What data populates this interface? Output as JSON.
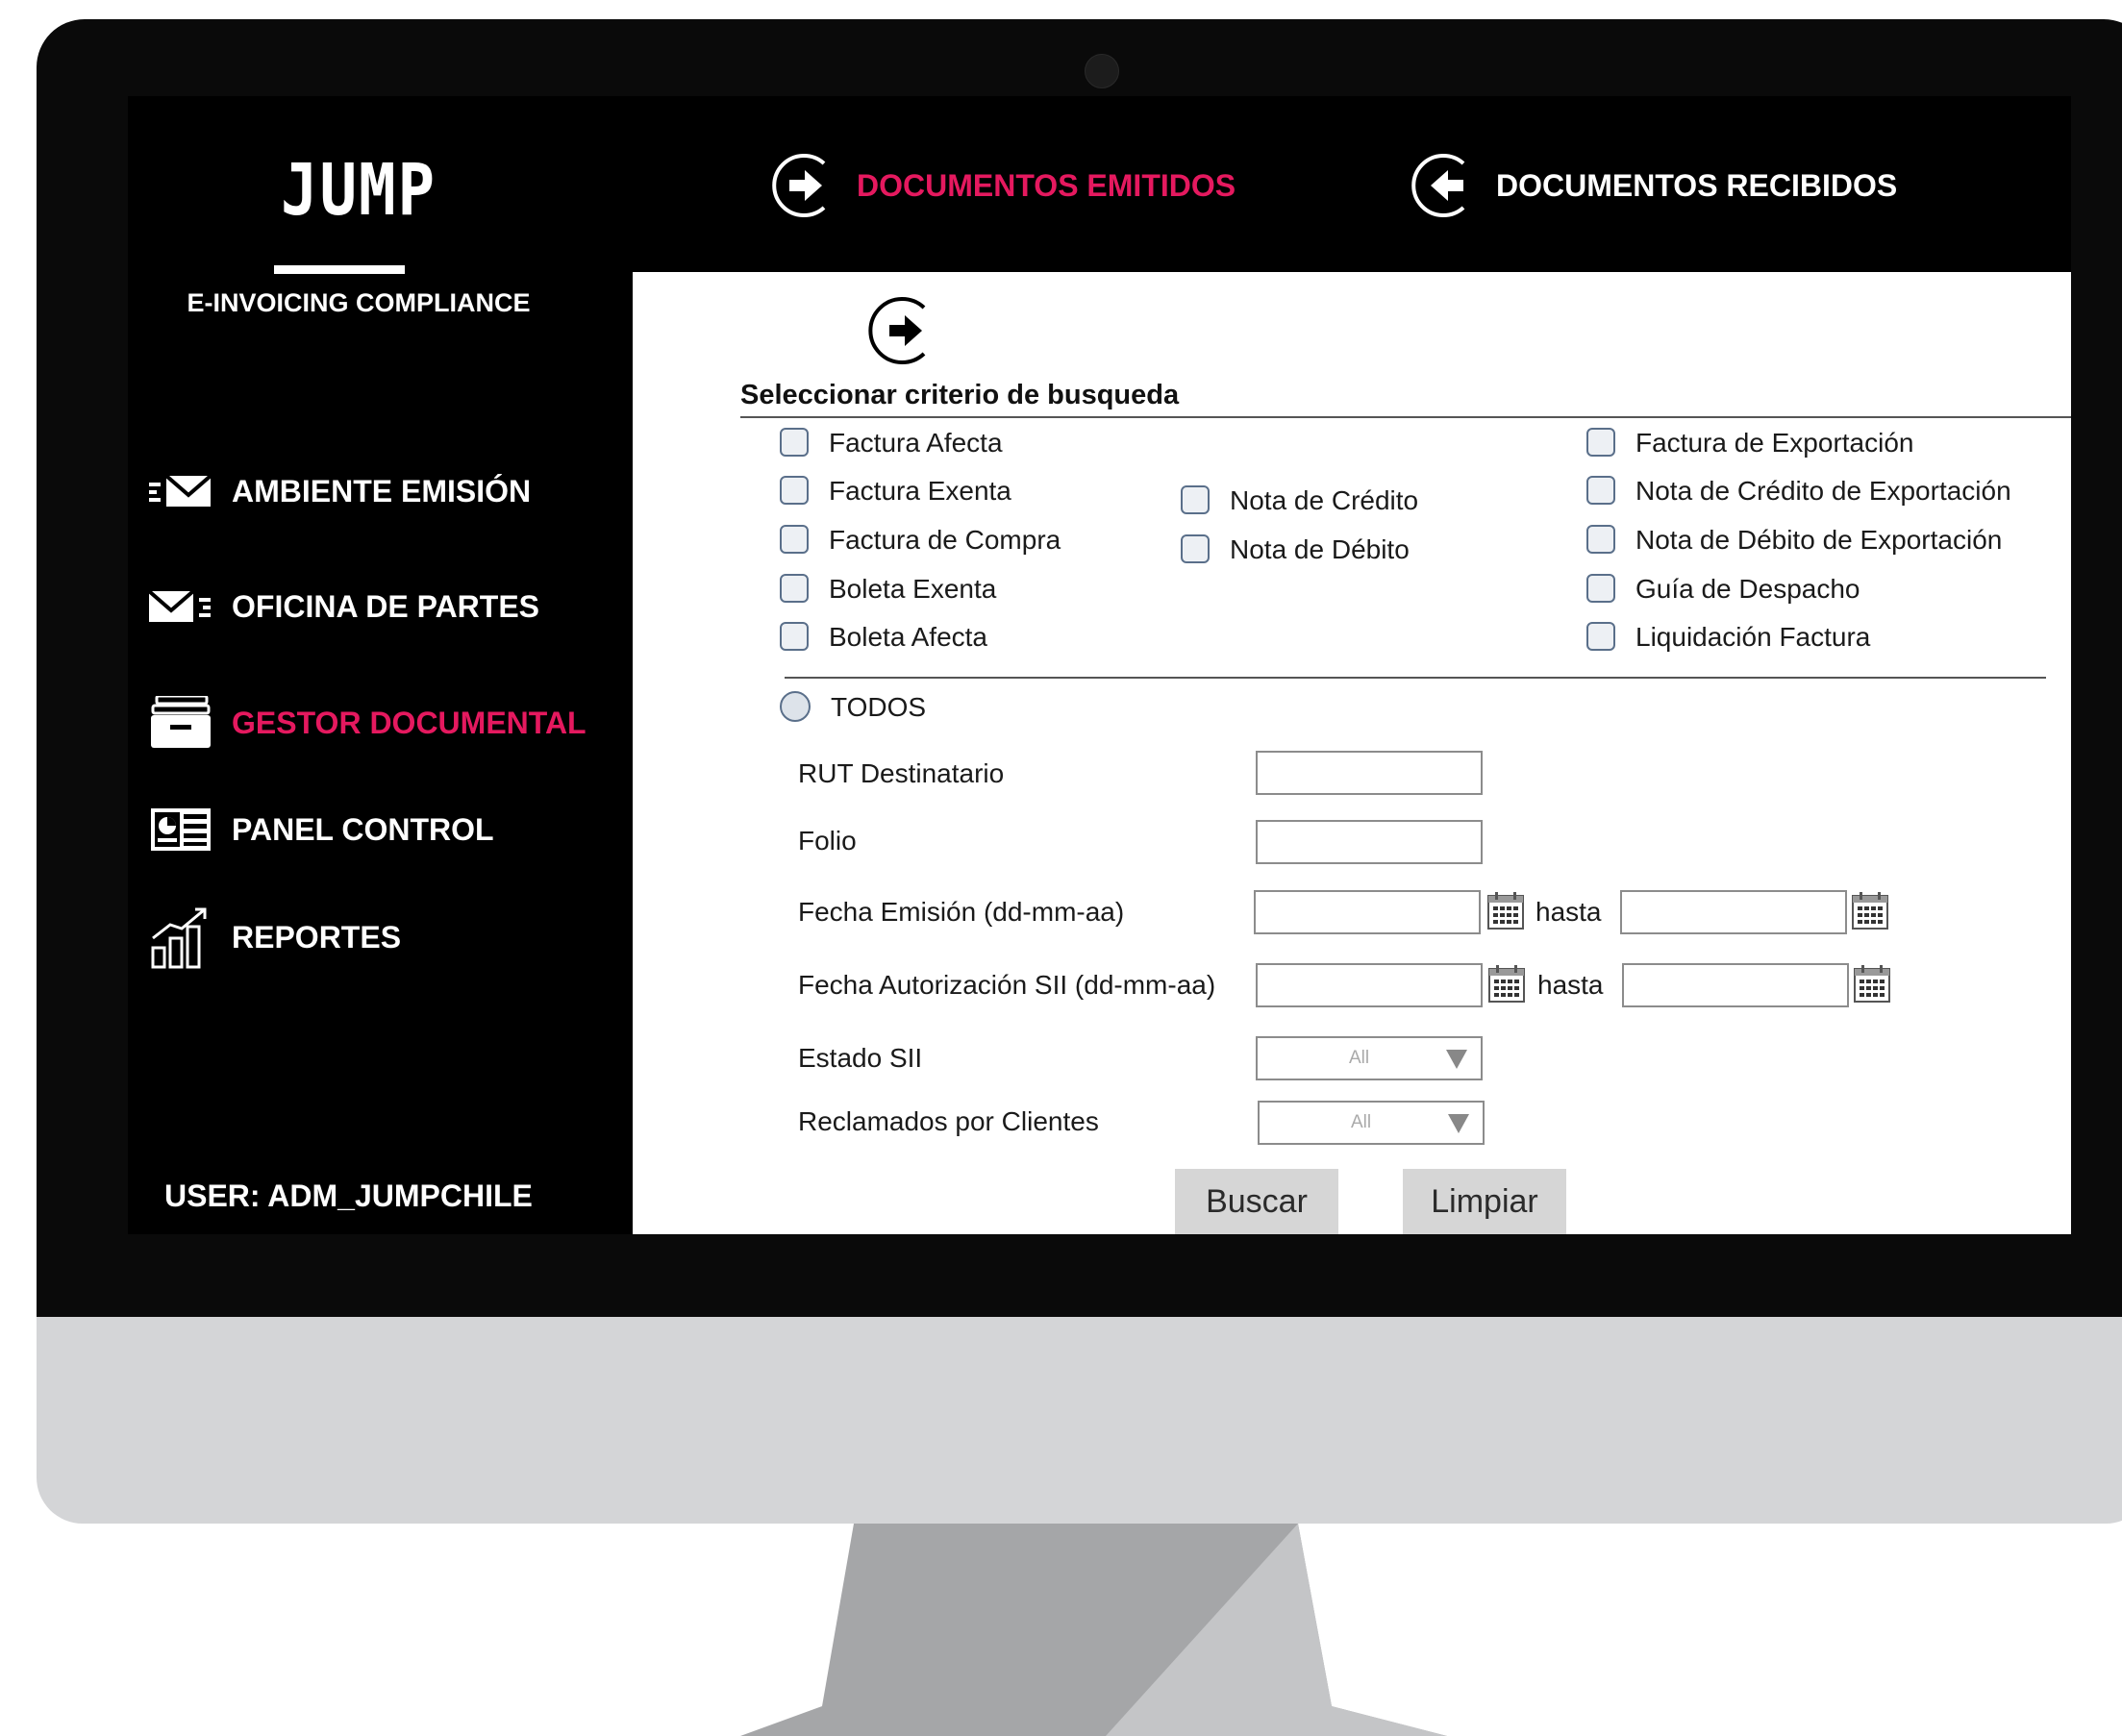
{
  "brand": {
    "logo": "JUMP",
    "tagline": "E-INVOICING COMPLIANCE"
  },
  "colors": {
    "accent": "#e5195f",
    "screen_bg": "#000000",
    "chin": "#d4d5d7",
    "stand": "#a5a6a8"
  },
  "sidebar": {
    "items": [
      {
        "label": "AMBIENTE EMISIÓN",
        "icon": "mail-out-icon",
        "active": false
      },
      {
        "label": "OFICINA DE PARTES",
        "icon": "mail-in-icon",
        "active": false
      },
      {
        "label": "GESTOR DOCUMENTAL",
        "icon": "file-box-icon",
        "active": true
      },
      {
        "label": "PANEL CONTROL",
        "icon": "dashboard-icon",
        "active": false
      },
      {
        "label": "REPORTES",
        "icon": "bar-chart-icon",
        "active": false
      }
    ],
    "user": "USER: ADM_JUMPCHILE"
  },
  "topnav": {
    "emitidos": {
      "label": "DOCUMENTOS EMITIDOS",
      "icon": "arrow-right-circle-icon",
      "active": true
    },
    "recibidos": {
      "label": "DOCUMENTOS RECIBIDOS",
      "icon": "arrow-left-circle-icon",
      "active": false
    }
  },
  "form": {
    "section_title": "Seleccionar criterio de busqueda",
    "doc_types_col1": [
      "Factura Afecta",
      "Factura Exenta",
      "Factura de Compra",
      "Boleta Exenta",
      "Boleta Afecta"
    ],
    "doc_types_col2": [
      "Nota de Crédito",
      "Nota de Débito"
    ],
    "doc_types_col3": [
      "Factura de Exportación",
      "Nota de Crédito de Exportación",
      "Nota de Débito de Exportación",
      "Guía de Despacho",
      "Liquidación Factura"
    ],
    "todos_label": "TODOS",
    "fields": {
      "rut": {
        "label": "RUT Destinatario",
        "value": ""
      },
      "folio": {
        "label": "Folio",
        "value": ""
      },
      "fecha_emision": {
        "label": "Fecha Emisión (dd-mm-aa)",
        "from": "",
        "to": "",
        "hasta": "hasta"
      },
      "fecha_autorizacion": {
        "label": "Fecha Autorización SII (dd-mm-aa)",
        "from": "",
        "to": "",
        "hasta": "hasta"
      },
      "estado_sii": {
        "label": "Estado SII",
        "selected": "All"
      },
      "reclamados": {
        "label": "Reclamados por Clientes",
        "selected": "All"
      }
    },
    "buttons": {
      "buscar": "Buscar",
      "limpiar": "Limpiar"
    }
  }
}
